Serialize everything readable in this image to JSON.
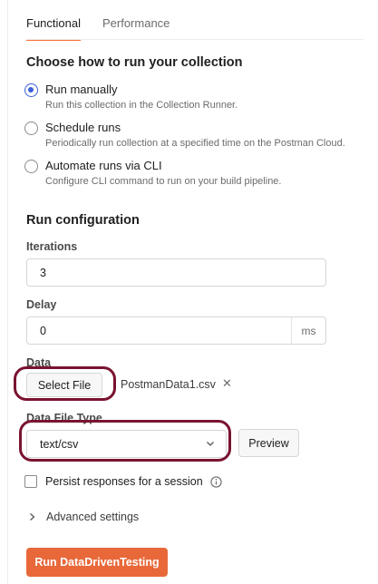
{
  "tabs": [
    {
      "label": "Functional",
      "active": true
    },
    {
      "label": "Performance",
      "active": false
    }
  ],
  "run_section": {
    "title": "Choose how to run your collection",
    "options": [
      {
        "label": "Run manually",
        "description": "Run this collection in the Collection Runner.",
        "selected": true
      },
      {
        "label": "Schedule runs",
        "description": "Periodically run collection at a specified time on the Postman Cloud.",
        "selected": false
      },
      {
        "label": "Automate runs via CLI",
        "description": "Configure CLI command to run on your build pipeline.",
        "selected": false
      }
    ]
  },
  "config": {
    "title": "Run configuration",
    "iterations": {
      "label": "Iterations",
      "value": "3"
    },
    "delay": {
      "label": "Delay",
      "value": "0",
      "unit": "ms"
    },
    "data": {
      "label": "Data",
      "button_label": "Select File",
      "file_name": "PostmanData1.csv"
    },
    "data_file_type": {
      "label": "Data File Type",
      "value": "text/csv",
      "preview_label": "Preview"
    },
    "persist": {
      "label": "Persist responses for a session",
      "checked": false
    },
    "advanced": {
      "label": "Advanced settings"
    }
  },
  "run_button": {
    "label": "Run DataDrivenTesting"
  },
  "colors": {
    "accent": "#ff6c37",
    "primary_button": "#e8683a",
    "radio_selected": "#3b5fd9",
    "highlight": "#7a1330"
  }
}
